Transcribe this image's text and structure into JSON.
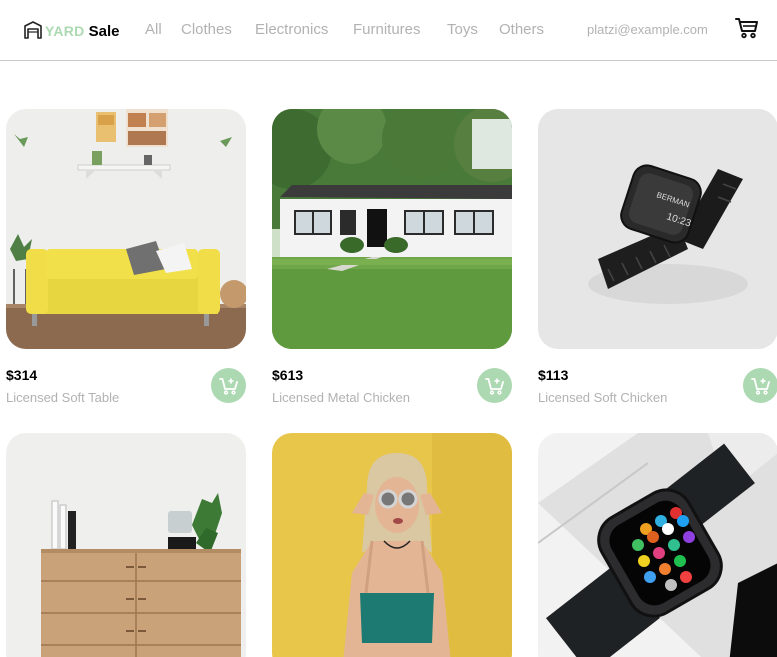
{
  "brand": {
    "yard": "YARD",
    "sale": "Sale"
  },
  "nav": {
    "all": "All",
    "clothes": "Clothes",
    "electronics": "Electronics",
    "furnitures": "Furnitures",
    "toys": "Toys",
    "others": "Others"
  },
  "user": {
    "email": "platzi@example.com"
  },
  "products": [
    {
      "price": "$314",
      "name": "Licensed Soft Table"
    },
    {
      "price": "$613",
      "name": "Licensed Metal Chicken"
    },
    {
      "price": "$113",
      "name": "Licensed Soft Chicken"
    },
    {
      "price": "",
      "name": ""
    },
    {
      "price": "",
      "name": ""
    },
    {
      "price": "",
      "name": ""
    }
  ],
  "colors": {
    "accent": "#acd9b2",
    "muted_text": "#b2b2b2",
    "divider": "#c8c8c8"
  },
  "icons": {
    "logo": "shop-building-icon",
    "cart": "shopping-cart-icon",
    "add_to_cart": "add-to-cart-icon"
  }
}
